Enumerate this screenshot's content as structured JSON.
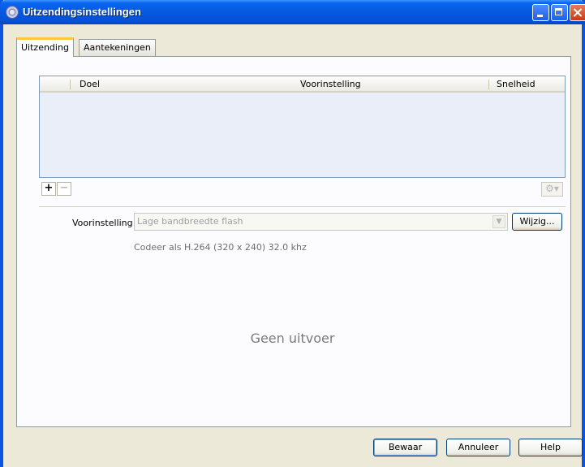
{
  "window": {
    "title": "Uitzendingsinstellingen"
  },
  "tabs": [
    {
      "label": "Uitzending"
    },
    {
      "label": "Aantekeningen"
    }
  ],
  "table": {
    "columns": [
      "Doel",
      "Voorinstelling",
      "Snelheid"
    ],
    "rows": []
  },
  "preset": {
    "label": "Voorinstelling",
    "value": "Lage bandbreedte flash",
    "edit_button": "Wijzig...",
    "encode_info": "Codeer als H.264 (320 x 240) 32.0 khz"
  },
  "status": {
    "no_output": "Geen uitvoer"
  },
  "buttons": {
    "add": "+",
    "remove": "−",
    "gear": "⚙▾",
    "save": "Bewaar",
    "cancel": "Annuleer",
    "help": "Help"
  },
  "colors": {
    "titlebar": "#0558e0",
    "tab_highlight": "#ffc83c",
    "background": "#ece9d8",
    "table_bg": "#e9eef9"
  }
}
